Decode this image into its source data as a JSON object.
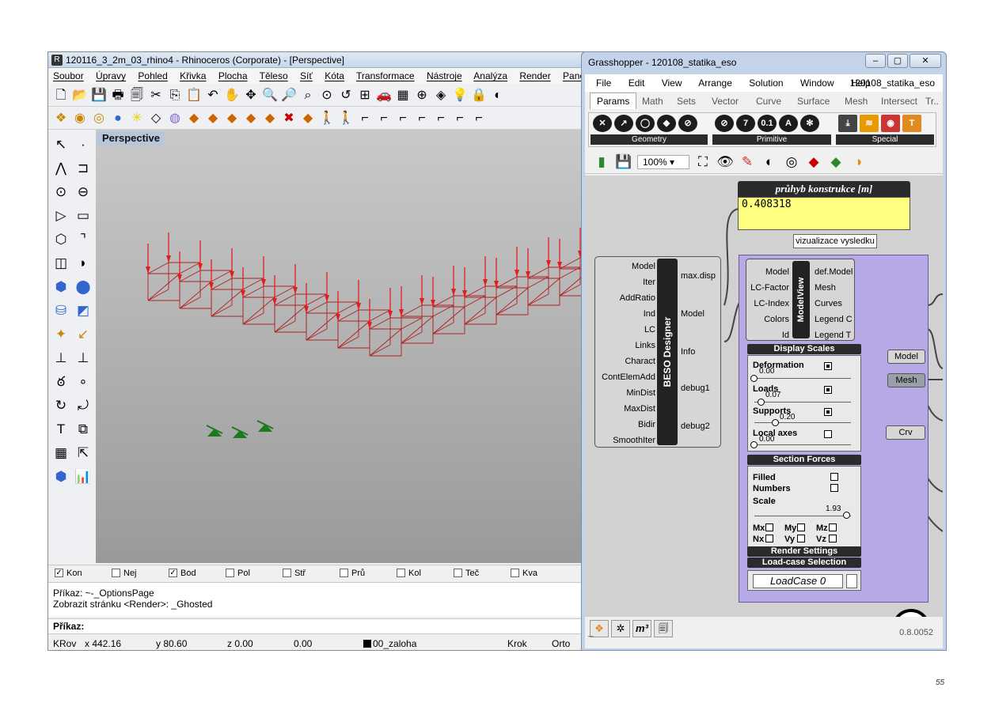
{
  "rhino": {
    "title": "120116_3_2m_03_rhino4 - Rhinoceros (Corporate) - [Perspective]",
    "menu": [
      "Soubor",
      "Úpravy",
      "Pohled",
      "Křivka",
      "Plocha",
      "Těleso",
      "Síť",
      "Kóta",
      "Transformace",
      "Nástroje",
      "Analýza",
      "Render",
      "Paneling To"
    ],
    "viewport_label": "Perspective",
    "osnaps": [
      {
        "label": "Kon",
        "checked": true
      },
      {
        "label": "Nej",
        "checked": false
      },
      {
        "label": "Bod",
        "checked": true
      },
      {
        "label": "Pol",
        "checked": false
      },
      {
        "label": "Stř",
        "checked": false
      },
      {
        "label": "Prů",
        "checked": false
      },
      {
        "label": "Kol",
        "checked": false
      },
      {
        "label": "Teč",
        "checked": false
      },
      {
        "label": "Kva",
        "checked": false
      }
    ],
    "command_history": [
      "Příkaz: ~-_OptionsPage",
      "Zobrazit stránku <Render>: _Ghosted"
    ],
    "command_prompt": "Příkaz:",
    "status": {
      "cplane": "KRov",
      "x": "x 442.16",
      "y": "y 80.60",
      "z": "z 0.00",
      "distance": "0.00",
      "layer": "00_zaloha",
      "snap": "Krok",
      "ortho": "Orto"
    },
    "colors": {
      "load_arrow": "#e02020",
      "frame_line": "#b02020",
      "support": "#1c7a1c",
      "viewport_label_bg": "#b7c6da"
    }
  },
  "grasshopper": {
    "title": "Grasshopper - 120108_statika_eso",
    "menu": [
      "File",
      "Edit",
      "View",
      "Arrange",
      "Solution",
      "Window",
      "Help"
    ],
    "document_name": "120108_statika_eso",
    "tabs": [
      "Params",
      "Math",
      "Sets",
      "Vector",
      "Curve",
      "Surface",
      "Mesh",
      "Intersect",
      "Tr.."
    ],
    "active_tab": "Params",
    "ribbon_groups": [
      {
        "name": "Geometry",
        "icons": [
          "point-icon",
          "vector-icon",
          "circle-icon",
          "box-icon",
          "brep-icon"
        ]
      },
      {
        "name": "Primitive",
        "icons": [
          "boolean-icon",
          "integer-icon",
          "number-icon",
          "text-icon",
          "color-icon"
        ]
      },
      {
        "name": "Special",
        "icons": [
          "download-icon",
          "slider-icon",
          "gradient-icon",
          "swatch-icon"
        ]
      }
    ],
    "zoom": "100%",
    "panel": {
      "title": "průhyb konstrukce [m]",
      "value": "0.408318"
    },
    "tooltip": "vizualizace vysledku",
    "beso": {
      "name": "BESO Designer",
      "inputs": [
        "Model",
        "Iter",
        "AddRatio",
        "Ind",
        "LC",
        "Links",
        "Charact",
        "ContElemAdd",
        "MinDist",
        "MaxDist",
        "Bidir",
        "SmoothIter"
      ],
      "outputs": [
        "max.disp",
        "Model",
        "Info",
        "debug1",
        "debug2"
      ]
    },
    "modelview": {
      "name": "ModelView",
      "inputs": [
        "Model",
        "LC-Factor",
        "LC-Index",
        "Colors",
        "Id"
      ],
      "outputs": [
        "def.Model",
        "Mesh",
        "Curves",
        "Legend C",
        "Legend T"
      ],
      "display_scales": {
        "title": "Display Scales",
        "items": [
          {
            "label": "Deformation",
            "value": "0.00",
            "checked": true
          },
          {
            "label": "Loads",
            "value": "0.07",
            "checked": true
          },
          {
            "label": "Supports",
            "value": "0.20",
            "checked": true
          },
          {
            "label": "Local axes",
            "value": "0.00",
            "checked": false
          }
        ]
      },
      "section_forces": {
        "title": "Section Forces",
        "filled": "Filled",
        "numbers": "Numbers",
        "scale": "Scale",
        "scale_value": "1.93",
        "force_checks": [
          "Mx",
          "My",
          "Mz",
          "Nx",
          "Vy",
          "Vz"
        ]
      },
      "render_settings": "Render Settings",
      "loadcase_selection": "Load-case Selection",
      "loadcase_value": "LoadCase 0"
    },
    "params": [
      "Model",
      "Mesh",
      "Crv"
    ],
    "version": "0.8.0052",
    "status_left": "_",
    "colors": {
      "canvas": "#d1d1d1",
      "modelview_bg": "#b7a8e6",
      "panel_bg": "#ffff80",
      "component_body": "#d6d6d6"
    }
  },
  "page_number": "55"
}
